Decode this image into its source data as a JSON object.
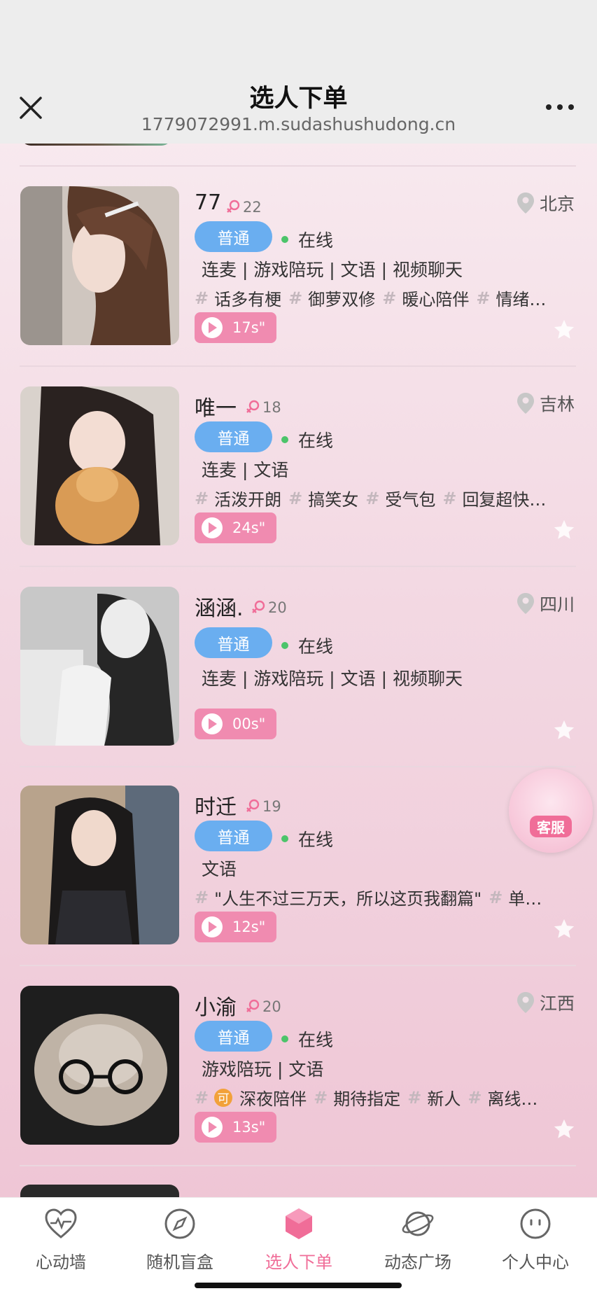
{
  "header": {
    "title": "选人下单",
    "url": "1779072991.m.sudashushudong.cn"
  },
  "profiles": [
    {
      "name": "77",
      "age": "22",
      "location": "北京",
      "level": "普通",
      "status": "在线",
      "services": "连麦 | 游戏陪玩 | 文语 | 视频聊天",
      "tags": [
        "话多有梗",
        "御萝双修",
        "暖心陪伴",
        "情绪…"
      ],
      "voice": "17s\""
    },
    {
      "name": "唯一",
      "age": "18",
      "location": "吉林",
      "level": "普通",
      "status": "在线",
      "services": "连麦 | 文语",
      "tags": [
        "活泼开朗",
        "搞笑女",
        "受气包",
        "回复超快…"
      ],
      "voice": "24s\""
    },
    {
      "name": "涵涵.",
      "age": "20",
      "location": "四川",
      "level": "普通",
      "status": "在线",
      "services": "连麦 | 游戏陪玩 | 文语 | 视频聊天",
      "tags": [],
      "voice": "00s\""
    },
    {
      "name": "时迁",
      "age": "19",
      "location": "",
      "level": "普通",
      "status": "在线",
      "services": "文语",
      "tags": [
        "\"人生不过三万天，所以这页我翻篇\"",
        "单…"
      ],
      "voice": "12s\""
    },
    {
      "name": "小渝",
      "age": "20",
      "location": "江西",
      "level": "普通",
      "status": "在线",
      "services": "游戏陪玩 | 文语",
      "tags": [
        "深夜陪伴",
        "期待指定",
        "新人",
        "离线…"
      ],
      "ke_badge": "可",
      "voice": "13s\""
    }
  ],
  "customer_service": {
    "label": "客服"
  },
  "tabbar": {
    "items": [
      {
        "label": "心动墙",
        "icon": "heart-pulse-icon"
      },
      {
        "label": "随机盲盒",
        "icon": "compass-icon"
      },
      {
        "label": "选人下单",
        "icon": "hexagon-icon",
        "active": true
      },
      {
        "label": "动态广场",
        "icon": "planet-icon"
      },
      {
        "label": "个人中心",
        "icon": "face-icon"
      }
    ]
  },
  "colors": {
    "accent_pink": "#f06d98",
    "badge_blue": "#6aaef0",
    "voice_pink": "#f08bb0",
    "online_green": "#4cc46a"
  }
}
